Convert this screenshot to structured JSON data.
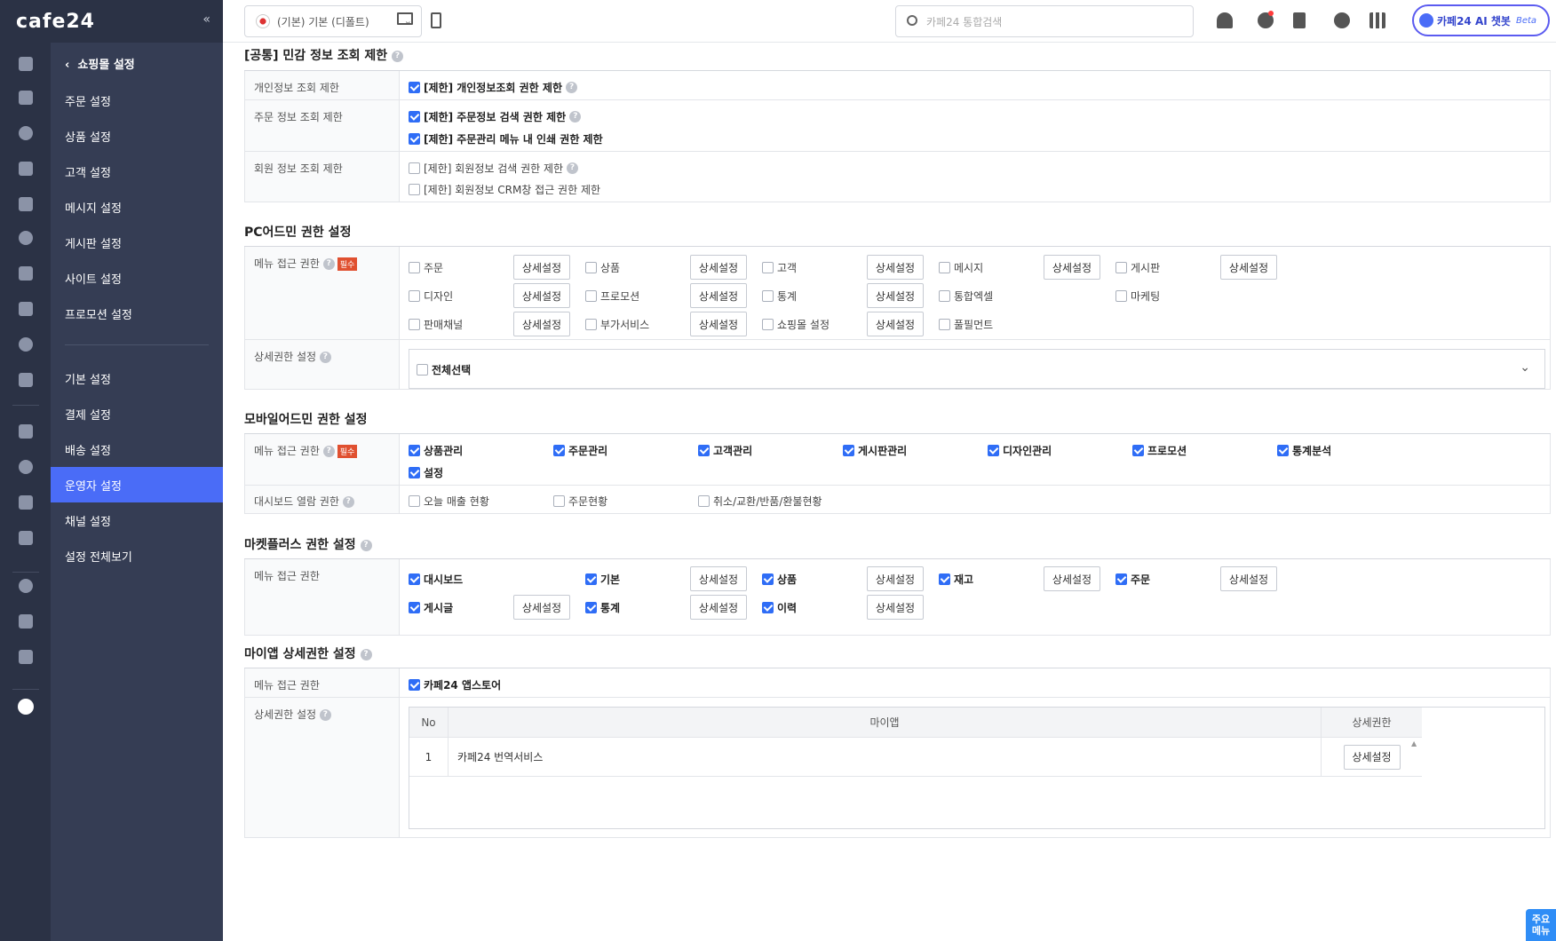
{
  "brand": {
    "logo": "cafe24",
    "collapse": "«"
  },
  "icon_bar": [
    "home-icon",
    "cart-icon",
    "shirt-icon",
    "person-icon",
    "chat-icon",
    "board-icon",
    "palette-icon",
    "promotion-icon",
    "chart-icon",
    "stats-icon",
    "store-icon",
    "megaphone-icon",
    "payment-icon",
    "delivery-icon",
    "apps-icon",
    "folder-icon",
    "copy-icon",
    "gear-icon"
  ],
  "submenu": {
    "back": "쇼핑몰 설정",
    "items": [
      "주문 설정",
      "상품 설정",
      "고객 설정",
      "메시지 설정",
      "게시판 설정",
      "사이트 설정",
      "프로모션 설정"
    ],
    "items2": [
      "기본 설정",
      "결제 설정",
      "배송 설정",
      "운영자 설정",
      "채널 설정",
      "설정 전체보기"
    ],
    "active": "운영자 설정"
  },
  "topbar": {
    "store": "(기본) 기본 (디폴트)",
    "search_placeholder": "카페24 통합검색",
    "ai_label": "카페24 AI 챗봇",
    "ai_beta": "Beta"
  },
  "sec1": {
    "title": "[공통] 민감 정보 조회 제한",
    "rows": [
      {
        "label": "개인정보 조회 제한",
        "items": [
          {
            "text": "[제한] 개인정보조회 권한 제한",
            "checked": true,
            "help": true
          }
        ]
      },
      {
        "label": "주문 정보 조회 제한",
        "items": [
          {
            "text": "[제한] 주문정보 검색 권한 제한",
            "checked": true,
            "help": true
          },
          {
            "text": "[제한] 주문관리 메뉴 내 인쇄 권한 제한",
            "checked": true,
            "help": false
          }
        ]
      },
      {
        "label": "회원 정보 조회 제한",
        "items": [
          {
            "text": "[제한] 회원정보 검색 권한 제한",
            "checked": false,
            "help": true
          },
          {
            "text": "[제한] 회원정보 CRM창 접근 권한 제한",
            "checked": false,
            "help": false
          }
        ]
      }
    ]
  },
  "sec2": {
    "title": "PC어드민 권한 설정",
    "menu_label": "메뉴 접근 권한",
    "required": "필수",
    "detail_btn": "상세설정",
    "menus": [
      [
        "주문",
        true
      ],
      [
        "상품",
        true
      ],
      [
        "고객",
        true
      ],
      [
        "메시지",
        true
      ],
      [
        "게시판",
        true
      ],
      [
        "디자인",
        true
      ],
      [
        "프로모션",
        true
      ],
      [
        "통계",
        true
      ],
      [
        "통합엑셀",
        false
      ],
      [
        "마케팅",
        false
      ],
      [
        "판매채널",
        true
      ],
      [
        "부가서비스",
        true
      ],
      [
        "쇼핑몰 설정",
        true
      ],
      [
        "풀필먼트",
        false
      ]
    ],
    "detail_label": "상세권한 설정",
    "select_all": "전체선택"
  },
  "sec3": {
    "title": "모바일어드민 권한 설정",
    "menu_label": "메뉴 접근 권한",
    "required": "필수",
    "menus": [
      "상품관리",
      "주문관리",
      "고객관리",
      "게시판관리",
      "디자인관리",
      "프로모션",
      "통계분석",
      "설정"
    ],
    "dashboard_label": "대시보드 열람 권한",
    "dashboard": [
      "오늘 매출 현황",
      "주문현황",
      "취소/교환/반품/환불현황"
    ]
  },
  "sec4": {
    "title": "마켓플러스 권한 설정",
    "menu_label": "메뉴 접근 권한",
    "detail_btn": "상세설정",
    "menus": [
      [
        "대시보드",
        false
      ],
      [
        "기본",
        true
      ],
      [
        "상품",
        true
      ],
      [
        "재고",
        true
      ],
      [
        "주문",
        true
      ],
      [
        "게시글",
        true
      ],
      [
        "통계",
        true
      ],
      [
        "이력",
        true
      ]
    ]
  },
  "sec5": {
    "title": "마이앱 상세권한 설정",
    "menu_label": "메뉴 접근 권한",
    "app_store": "카페24 앱스토어",
    "detail_label": "상세권한 설정",
    "headers": [
      "No",
      "마이앱",
      "상세권한"
    ],
    "rows": [
      {
        "no": "1",
        "app": "카페24 번역서비스",
        "btn": "상세설정"
      }
    ]
  },
  "float": {
    "main_menu": "주요 메뉴"
  }
}
